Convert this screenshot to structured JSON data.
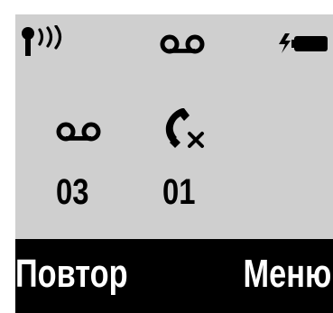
{
  "colors": {
    "screen_bg": "#cfcfcf",
    "softkey_bar_bg": "#000000",
    "softkey_text": "#ffffff",
    "foreground": "#000000"
  },
  "status_bar": {
    "icons": [
      "signal-icon",
      "voicemail-icon",
      "battery-charging-icon"
    ]
  },
  "events": {
    "voicemail": {
      "icon": "voicemail-icon",
      "count": "03"
    },
    "missed_calls": {
      "icon": "missed-call-icon",
      "count": "01"
    }
  },
  "softkeys": {
    "left_label": "Повтор",
    "right_label": "Меню"
  }
}
